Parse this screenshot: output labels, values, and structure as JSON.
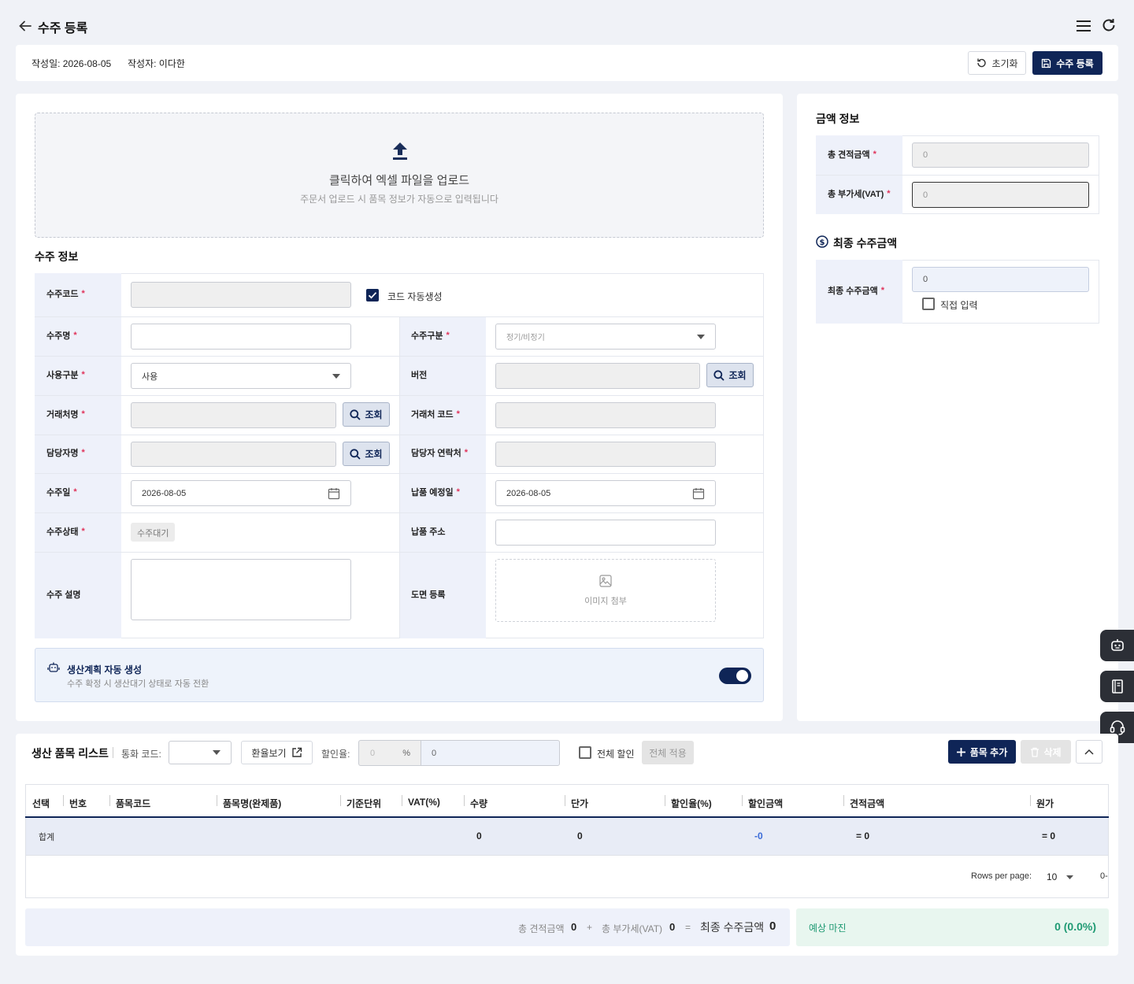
{
  "header": {
    "title": "수주 등록"
  },
  "meta": {
    "created_date": "작성일: 2026-08-05",
    "author": "작성자: 이다한",
    "reset_label": "초기화",
    "submit_label": "수주 등록"
  },
  "upload": {
    "title": "클릭하여 엑셀 파일을 업로드",
    "subtitle": "주문서 업로드 시 품목 정보가 자동으로 입력됩니다"
  },
  "order_info": {
    "section_title": "수주 정보",
    "code_label": "수주코드",
    "auto_code_label": "코드 자동생성",
    "auto_code_checked": true,
    "name_label": "수주명",
    "type_label": "수주구분",
    "type_placeholder": "정기/비정기",
    "usage_label": "사용구분",
    "usage_value": "사용",
    "version_label": "버전",
    "client_name_label": "거래처명",
    "client_code_label": "거래처 코드",
    "manager_label": "담당자명",
    "manager_contact_label": "담당자 연락처",
    "order_date_label": "수주일",
    "order_date_value": "2026-08-05",
    "delivery_date_label": "납품 예정일",
    "delivery_date_value": "2026-08-05",
    "status_label": "수주상태",
    "status_value": "수주대기",
    "address_label": "납품 주소",
    "desc_label": "수주 설명",
    "drawing_label": "도면 등록",
    "attach_label": "이미지 첨부",
    "search_label": "조회"
  },
  "auto_plan": {
    "title": "생산계획 자동 생성",
    "subtitle": "수주 확정 시 생산대기 상태로 자동 전환",
    "enabled": true
  },
  "amount": {
    "section_title": "금액 정보",
    "total_estimate_label": "총 견적금액",
    "total_estimate_value": "0",
    "total_vat_label": "총 부가세(VAT)",
    "total_vat_value": "0",
    "final_title": "최종 수주금액",
    "final_label": "최종 수주금액",
    "final_value": "0",
    "manual_label": "직접 입력"
  },
  "items": {
    "title": "생산 품목 리스트",
    "currency_label": "통화 코드:",
    "exchange_label": "환율보기",
    "discount_label": "할인율:",
    "discount_pct_placeholder": "0",
    "discount_pct_unit": "%",
    "discount_amount_value": "0",
    "all_discount_label": "전체 할인",
    "apply_all_label": "전체 적용",
    "add_label": "품목 추가",
    "delete_label": "삭제",
    "columns": [
      "선택",
      "번호",
      "품목코드",
      "품목명(완제품)",
      "기준단위",
      "VAT(%)",
      "수량",
      "단가",
      "할인율(%)",
      "할인금액",
      "견적금액",
      "원가"
    ],
    "total_row": {
      "label": "합계",
      "qty": "0",
      "unit_price": "0",
      "discount_amount": "-0",
      "estimate": "= 0",
      "cost": "= 0"
    },
    "rows_per_page_label": "Rows per page:",
    "rows_per_page_value": "10",
    "page_range": "0-"
  },
  "summary": {
    "total_estimate_label": "총 견적금액",
    "total_estimate_value": "0",
    "plus": "+",
    "total_vat_label": "총 부가세(VAT)",
    "total_vat_value": "0",
    "equals": "=",
    "final_label": "최종 수주금액",
    "final_value": "0",
    "margin_label": "예상 마진",
    "margin_value": "0 (0.0%)"
  },
  "colors": {
    "navy": "#0f2557",
    "required": "#e0335a",
    "margin_green": "#1f9a73",
    "label_bg": "#eef1fa"
  }
}
